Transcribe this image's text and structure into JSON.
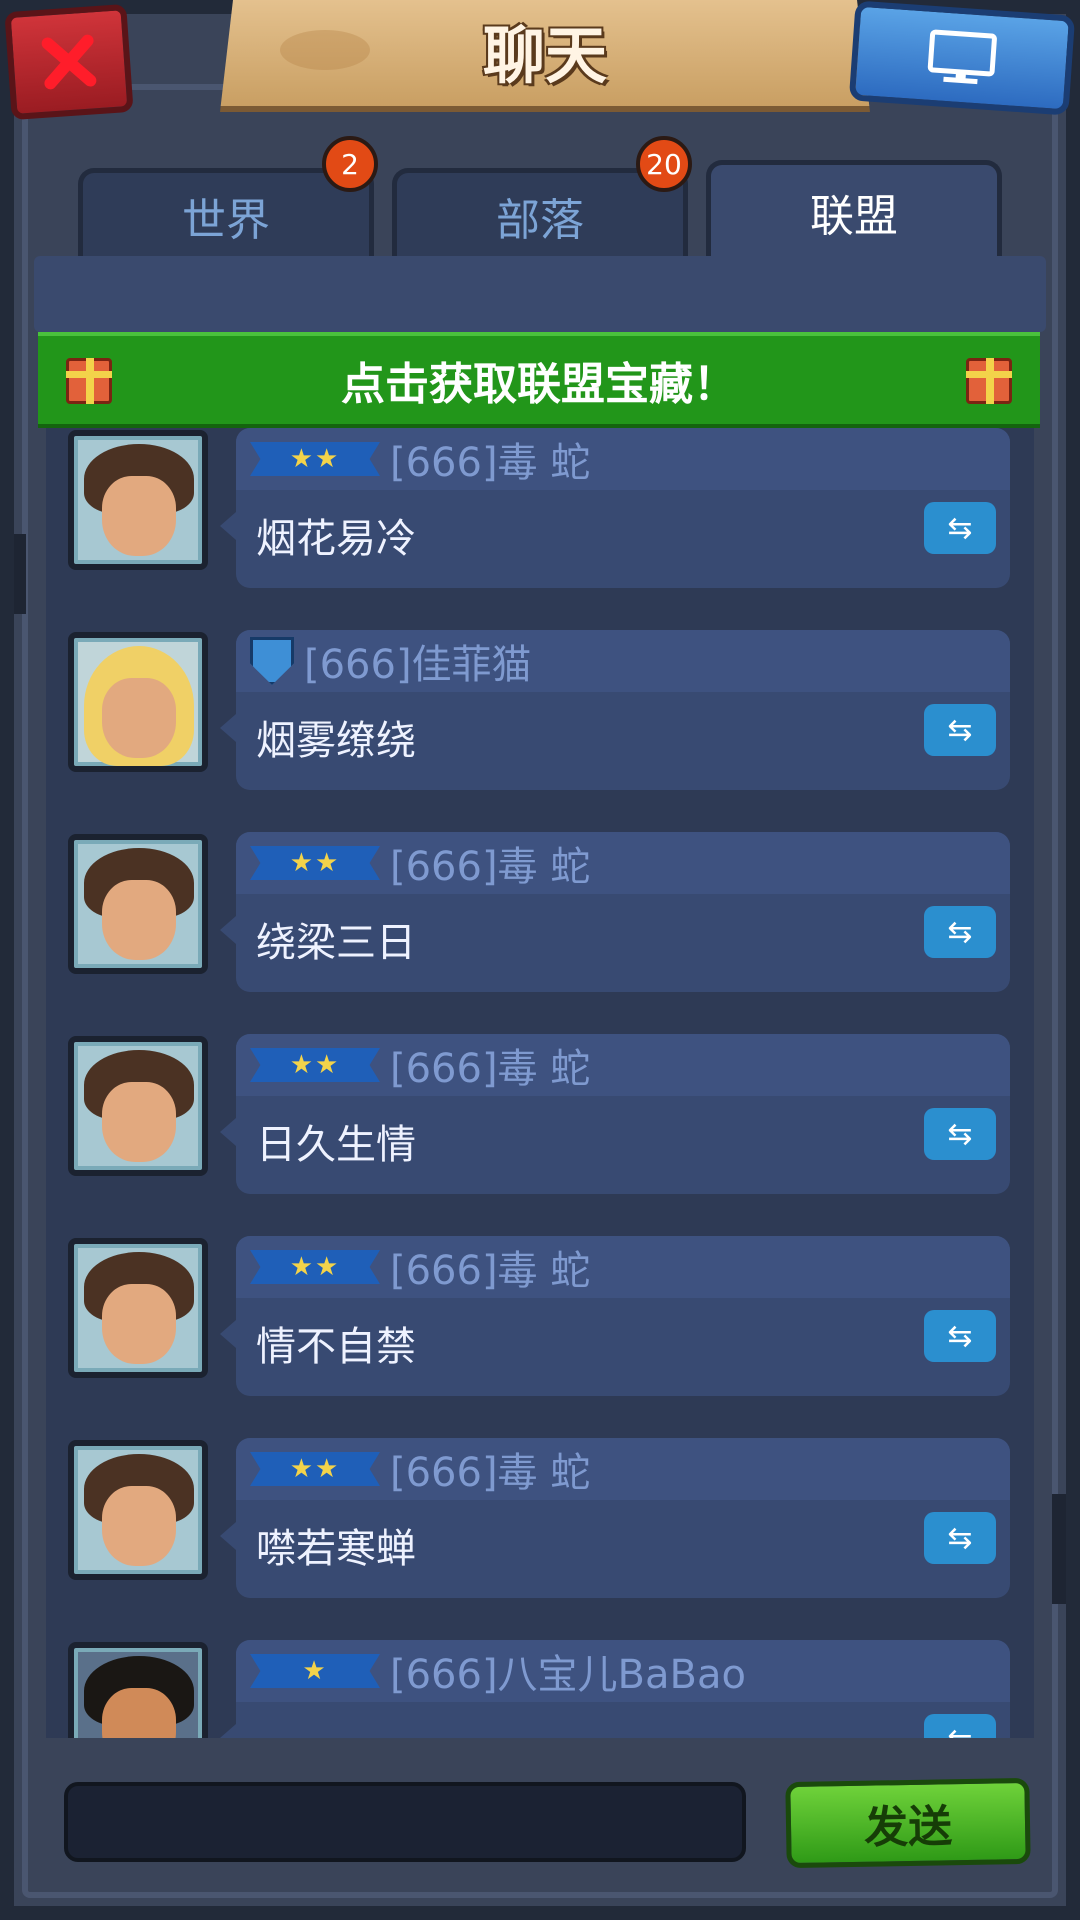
{
  "header": {
    "title": "聊天"
  },
  "tabs": [
    {
      "label": "世界",
      "badge": "2"
    },
    {
      "label": "部落",
      "badge": "20"
    },
    {
      "label": "联盟",
      "badge": ""
    }
  ],
  "active_tab": "联盟",
  "treasure_banner": {
    "text": "点击获取联盟宝藏！"
  },
  "messages": [
    {
      "rank_stars": "★★",
      "name": "[666]毒 蛇",
      "text": "烟花易冷",
      "avatar": "brunette"
    },
    {
      "rank_stars": "",
      "name": "[666]佳菲猫",
      "text": "烟雾缭绕",
      "avatar": "blonde"
    },
    {
      "rank_stars": "★★",
      "name": "[666]毒 蛇",
      "text": "绕梁三日",
      "avatar": "brunette"
    },
    {
      "rank_stars": "★★",
      "name": "[666]毒 蛇",
      "text": "日久生情",
      "avatar": "brunette"
    },
    {
      "rank_stars": "★★",
      "name": "[666]毒 蛇",
      "text": "情不自禁",
      "avatar": "brunette"
    },
    {
      "rank_stars": "★★",
      "name": "[666]毒 蛇",
      "text": "噤若寒蝉",
      "avatar": "brunette"
    },
    {
      "rank_stars": "★",
      "name": "[666]八宝儿BaBao",
      "text": "",
      "avatar": "male"
    }
  ],
  "input": {
    "value": "",
    "placeholder": ""
  },
  "send_button": {
    "label": "发送"
  },
  "icons": {
    "close": "close-icon",
    "screen": "monitor-icon",
    "gift": "gift-icon",
    "reply": "reply-icon"
  },
  "colors": {
    "active_tab": "#3a4a6e",
    "badge": "#e24a15",
    "treasure_bar": "#22961a",
    "send_button": "#3fb522",
    "close_button": "#c42a30",
    "screen_button": "#3a82d4"
  }
}
